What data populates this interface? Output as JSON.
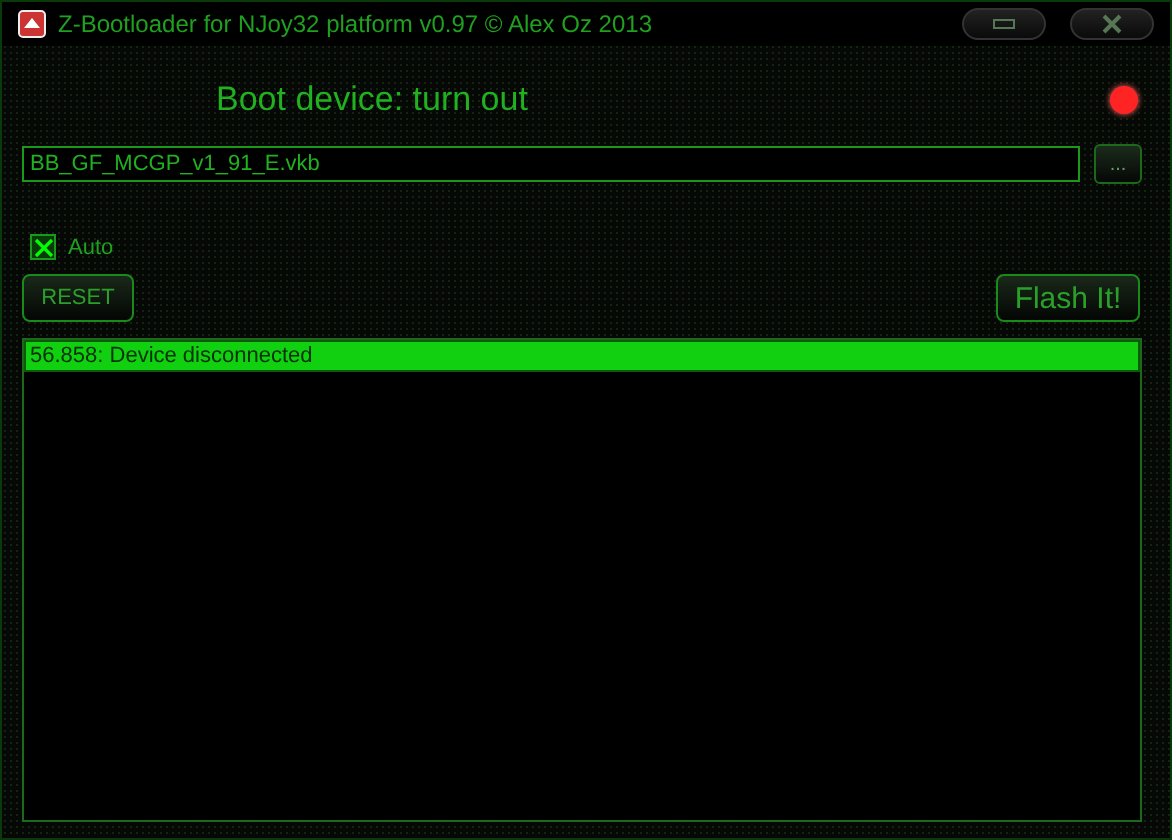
{
  "window": {
    "title": "Z-Bootloader for NJoy32 platform v0.97 © Alex Oz 2013"
  },
  "status": {
    "text": "Boot device: turn out",
    "connected": false
  },
  "file_field": {
    "value": "BB_GF_MCGP_v1_91_E.vkb"
  },
  "browse_button": {
    "label": "..."
  },
  "auto_checkbox": {
    "label": "Auto",
    "checked": true
  },
  "buttons": [
    {
      "label": "RESET",
      "kind": "small"
    },
    {
      "label": "Flash It!",
      "kind": "large"
    }
  ],
  "log": [
    {
      "text": "56.858: Device disconnected",
      "selected": true
    }
  ]
}
